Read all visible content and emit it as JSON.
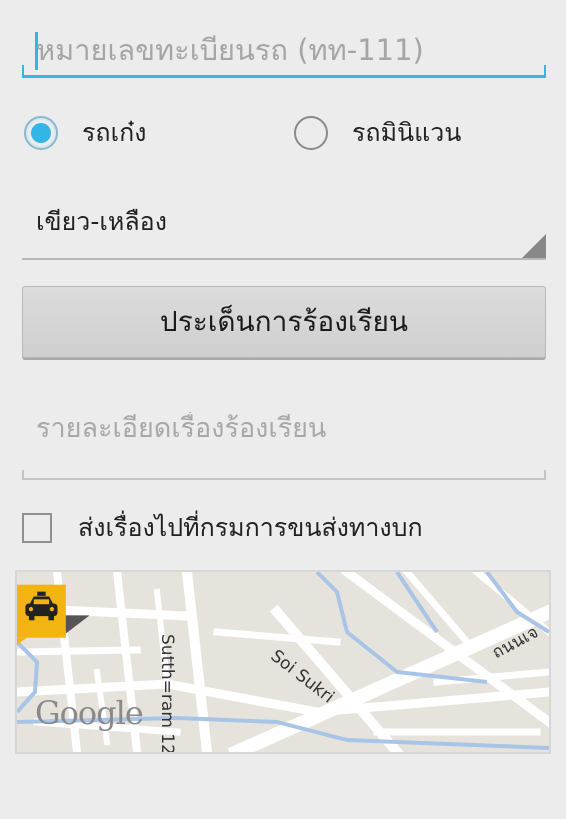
{
  "form": {
    "plate_placeholder": "หมายเลขทะเบียนรถ (ทท-111)",
    "car_type_options": [
      "รถเก๋ง",
      "รถมินิแวน"
    ],
    "car_type_selected": "รถเก๋ง",
    "color_selected": "เขียว-เหลือง",
    "issue_button_label": "ประเด็นการร้องเรียน",
    "details_placeholder": "รายละเอียดเรื่องร้องเรียน",
    "send_to_dlt_label": "ส่งเรื่องไปที่กรมการขนส่งทางบก",
    "send_to_dlt_checked": false
  },
  "map": {
    "streets": [
      "Sutth=ram 12",
      "Soi Sukri",
      "ถนนเจ"
    ],
    "attribution": "Google",
    "marker_icon": "taxi-icon",
    "colors": {
      "marker_bg": "#f2b411",
      "water": "#a8c4e6",
      "road": "#ffffff"
    }
  },
  "colors": {
    "accent": "#33b5e5",
    "background": "#ececec"
  }
}
